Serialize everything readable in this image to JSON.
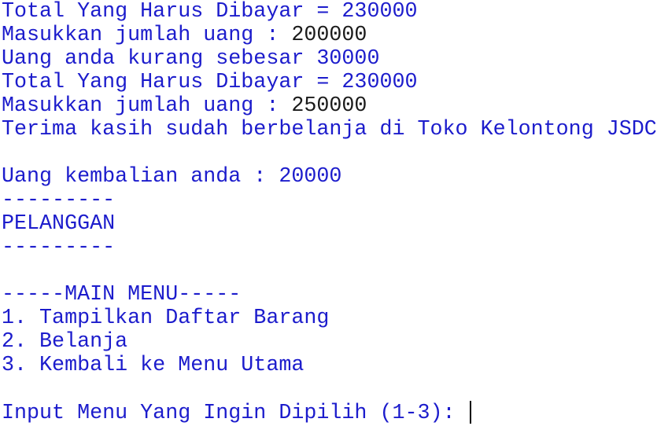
{
  "console": {
    "lines": [
      {
        "label": "Total Yang Harus Dibayar = 230000"
      },
      {
        "label": "Masukkan jumlah uang : ",
        "input": "200000"
      },
      {
        "label": "Uang anda kurang sebesar 30000"
      },
      {
        "label": "Total Yang Harus Dibayar = 230000"
      },
      {
        "label": "Masukkan jumlah uang : ",
        "input": "250000"
      },
      {
        "label": "Terima kasih sudah berbelanja di Toko Kelontong JSDC"
      },
      {
        "label": ""
      },
      {
        "label": "Uang kembalian anda : 20000"
      },
      {
        "label": "---------"
      },
      {
        "label": "PELANGGAN"
      },
      {
        "label": "---------"
      },
      {
        "label": ""
      },
      {
        "label": "-----MAIN MENU-----"
      },
      {
        "label": "1. Tampilkan Daftar Barang"
      },
      {
        "label": "2. Belanja"
      },
      {
        "label": "3. Kembali ke Menu Utama"
      },
      {
        "label": ""
      },
      {
        "label": "Input Menu Yang Ingin Dipilih (1-3): "
      }
    ]
  },
  "colors": {
    "output_text": "#1c1ccc",
    "user_input_text": "#1a1a1a",
    "background": "#ffffff",
    "cursor": "#000000"
  }
}
